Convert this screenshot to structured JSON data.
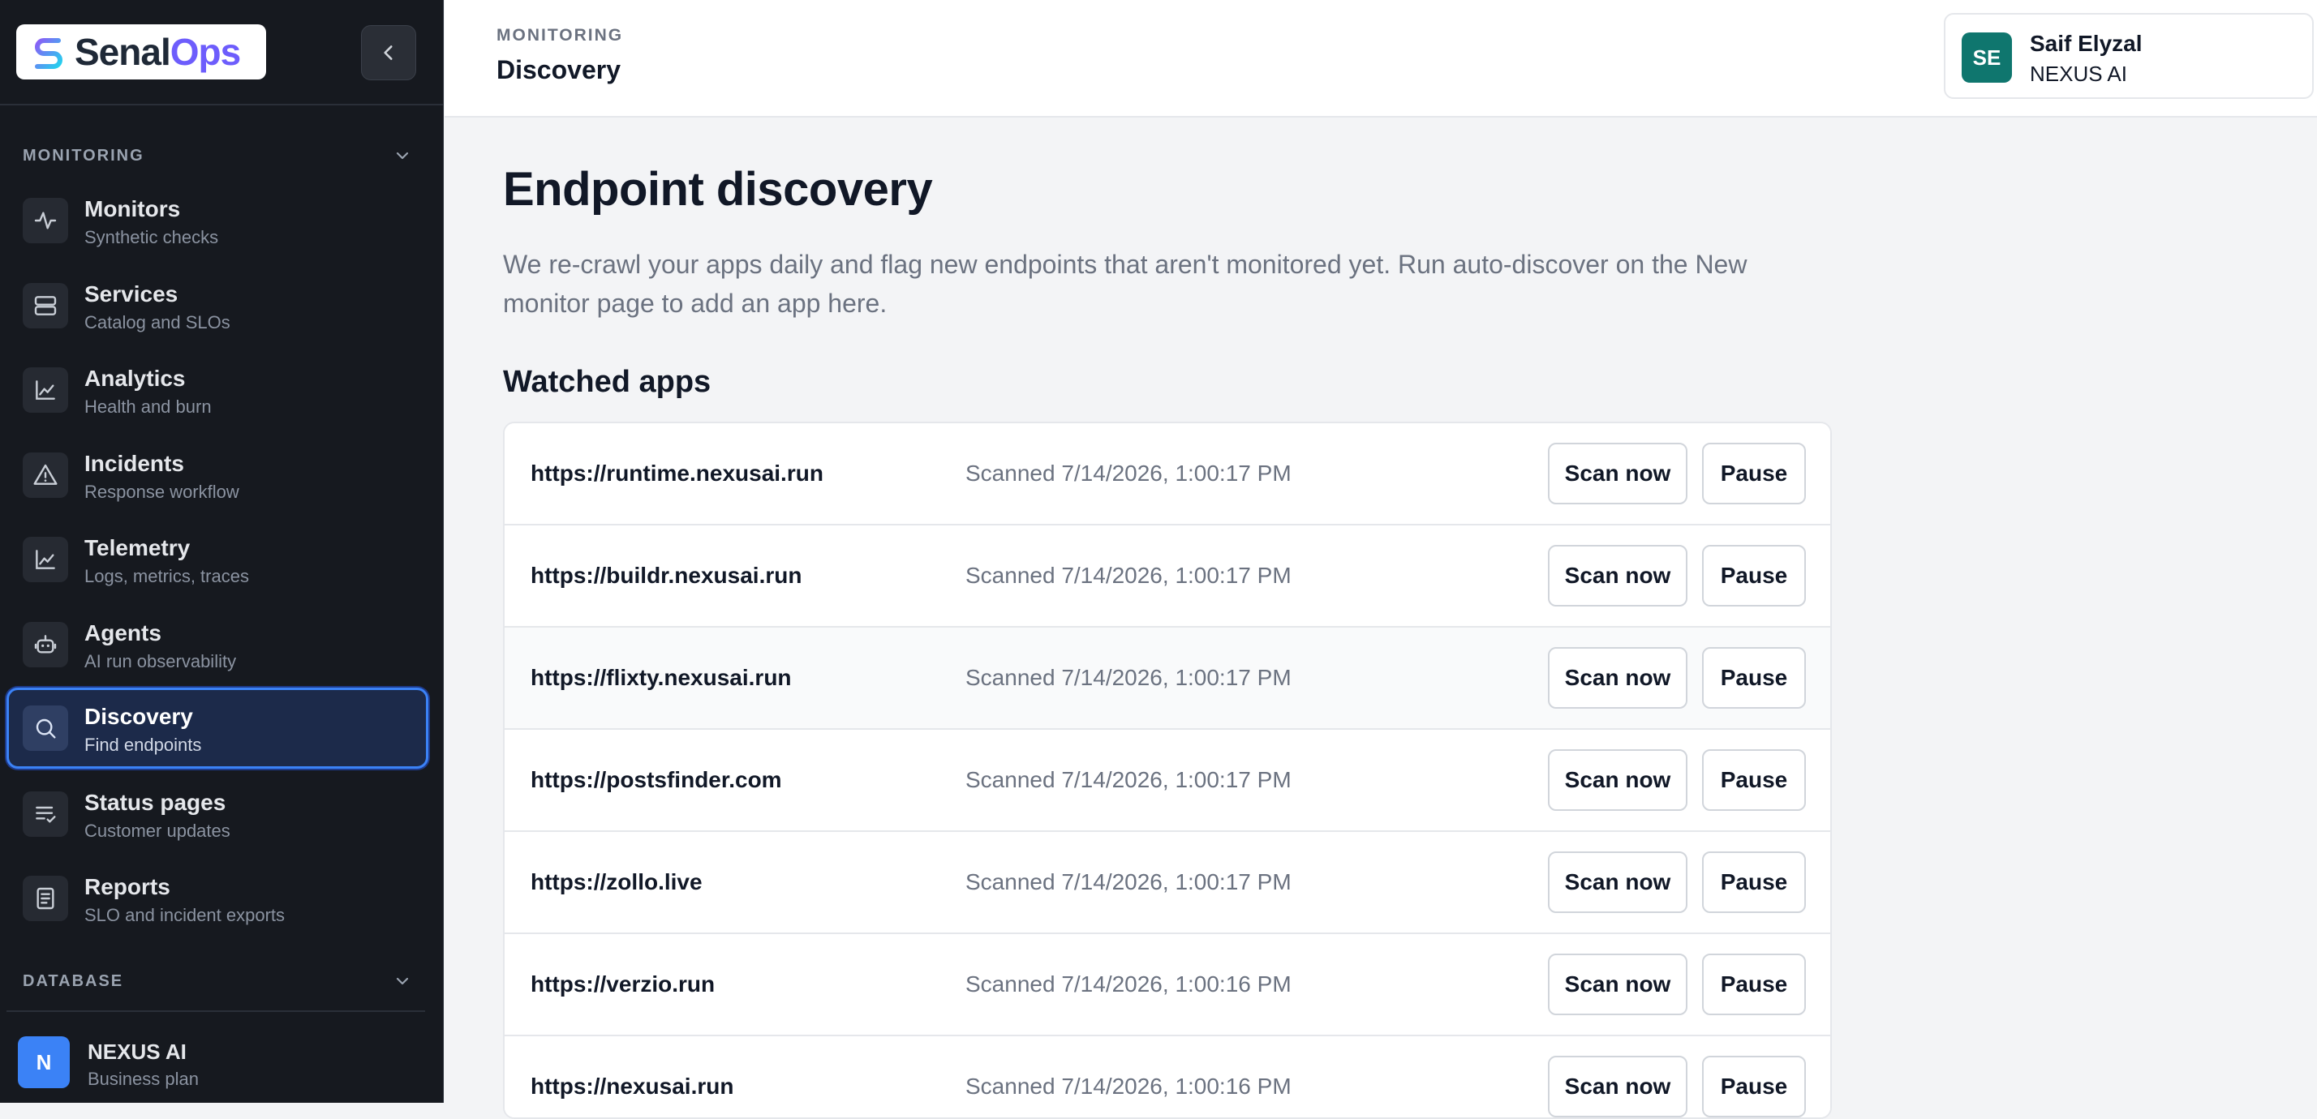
{
  "brand": {
    "logo_part1": "Senal",
    "logo_part2": "Ops"
  },
  "colors": {
    "sidebar_bg": "#16191f",
    "accent": "#3b82f6",
    "user_avatar": "#0f766e",
    "org_avatar": "#3b82f6",
    "logo_purple": "#6d5dfc"
  },
  "sidebar": {
    "sections": [
      {
        "title": "MONITORING",
        "icon": "chevron-down-icon"
      },
      {
        "title": "DATABASE",
        "icon": "chevron-down-icon"
      }
    ],
    "items": [
      {
        "label": "Monitors",
        "sub": "Synthetic checks",
        "icon": "pulse-icon"
      },
      {
        "label": "Services",
        "sub": "Catalog and SLOs",
        "icon": "server-icon"
      },
      {
        "label": "Analytics",
        "sub": "Health and burn",
        "icon": "line-chart-icon"
      },
      {
        "label": "Incidents",
        "sub": "Response workflow",
        "icon": "warning-icon"
      },
      {
        "label": "Telemetry",
        "sub": "Logs, metrics, traces",
        "icon": "line-chart-icon"
      },
      {
        "label": "Agents",
        "sub": "AI run observability",
        "icon": "robot-icon"
      },
      {
        "label": "Discovery",
        "sub": "Find endpoints",
        "icon": "search-icon",
        "active": true
      },
      {
        "label": "Status pages",
        "sub": "Customer updates",
        "icon": "checklist-icon"
      },
      {
        "label": "Reports",
        "sub": "SLO and incident exports",
        "icon": "document-icon"
      }
    ],
    "org": {
      "initial": "N",
      "name": "NEXUS AI",
      "plan": "Business plan"
    }
  },
  "header": {
    "breadcrumb": "MONITORING",
    "title": "Discovery",
    "user": {
      "initials": "SE",
      "name": "Saif Elyzal",
      "org": "NEXUS AI"
    }
  },
  "main": {
    "heading": "Endpoint discovery",
    "intro": "We re-crawl your apps daily and flag new endpoints that aren't monitored yet. Run auto-discover on the New monitor page to add an app here.",
    "section_title": "Watched apps",
    "scan_label": "Scan now",
    "pause_label": "Pause",
    "apps": [
      {
        "url": "https://runtime.nexusai.run",
        "scanned": "Scanned 7/14/2026, 1:00:17 PM"
      },
      {
        "url": "https://buildr.nexusai.run",
        "scanned": "Scanned 7/14/2026, 1:00:17 PM"
      },
      {
        "url": "https://flixty.nexusai.run",
        "scanned": "Scanned 7/14/2026, 1:00:17 PM"
      },
      {
        "url": "https://postsfinder.com",
        "scanned": "Scanned 7/14/2026, 1:00:17 PM"
      },
      {
        "url": "https://zollo.live",
        "scanned": "Scanned 7/14/2026, 1:00:17 PM"
      },
      {
        "url": "https://verzio.run",
        "scanned": "Scanned 7/14/2026, 1:00:16 PM"
      },
      {
        "url": "https://nexusai.run",
        "scanned": "Scanned 7/14/2026, 1:00:16 PM"
      }
    ]
  }
}
